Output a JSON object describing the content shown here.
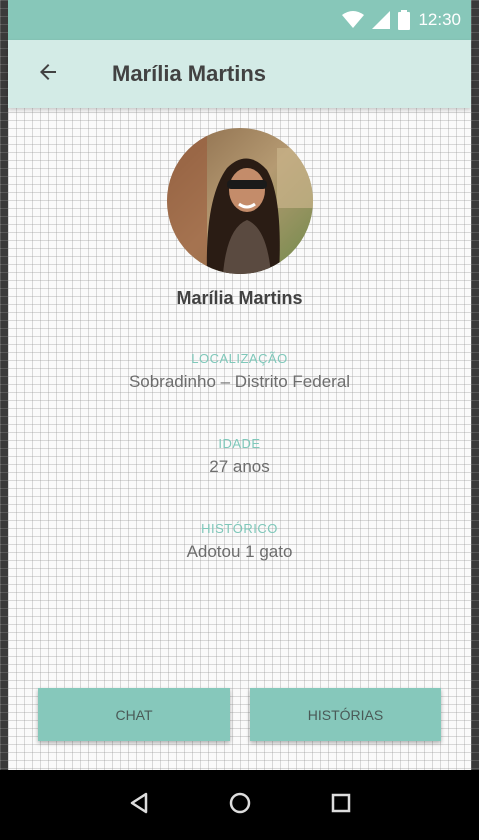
{
  "status_bar": {
    "time": "12:30",
    "icons": [
      "wifi-icon",
      "signal-icon",
      "battery-icon"
    ]
  },
  "app_bar": {
    "back_icon": "arrow-left-icon",
    "title": "Marília Martins"
  },
  "profile": {
    "name": "Marília Martins",
    "fields": [
      {
        "label": "LOCALIZAÇÃO",
        "value": "Sobradinho – Distrito Federal"
      },
      {
        "label": "IDADE",
        "value": "27 anos"
      },
      {
        "label": "HISTÓRICO",
        "value": "Adotou 1 gato"
      }
    ]
  },
  "actions": {
    "chat_label": "CHAT",
    "stories_label": "HISTÓRIAS"
  },
  "nav_bar": {
    "icons": [
      "back-triangle-icon",
      "home-circle-icon",
      "recents-square-icon"
    ]
  },
  "colors": {
    "status_bar": "#87c7b9",
    "app_bar": "#d3ebe6",
    "accent": "#7fc8ba",
    "button": "#86c8bb"
  }
}
